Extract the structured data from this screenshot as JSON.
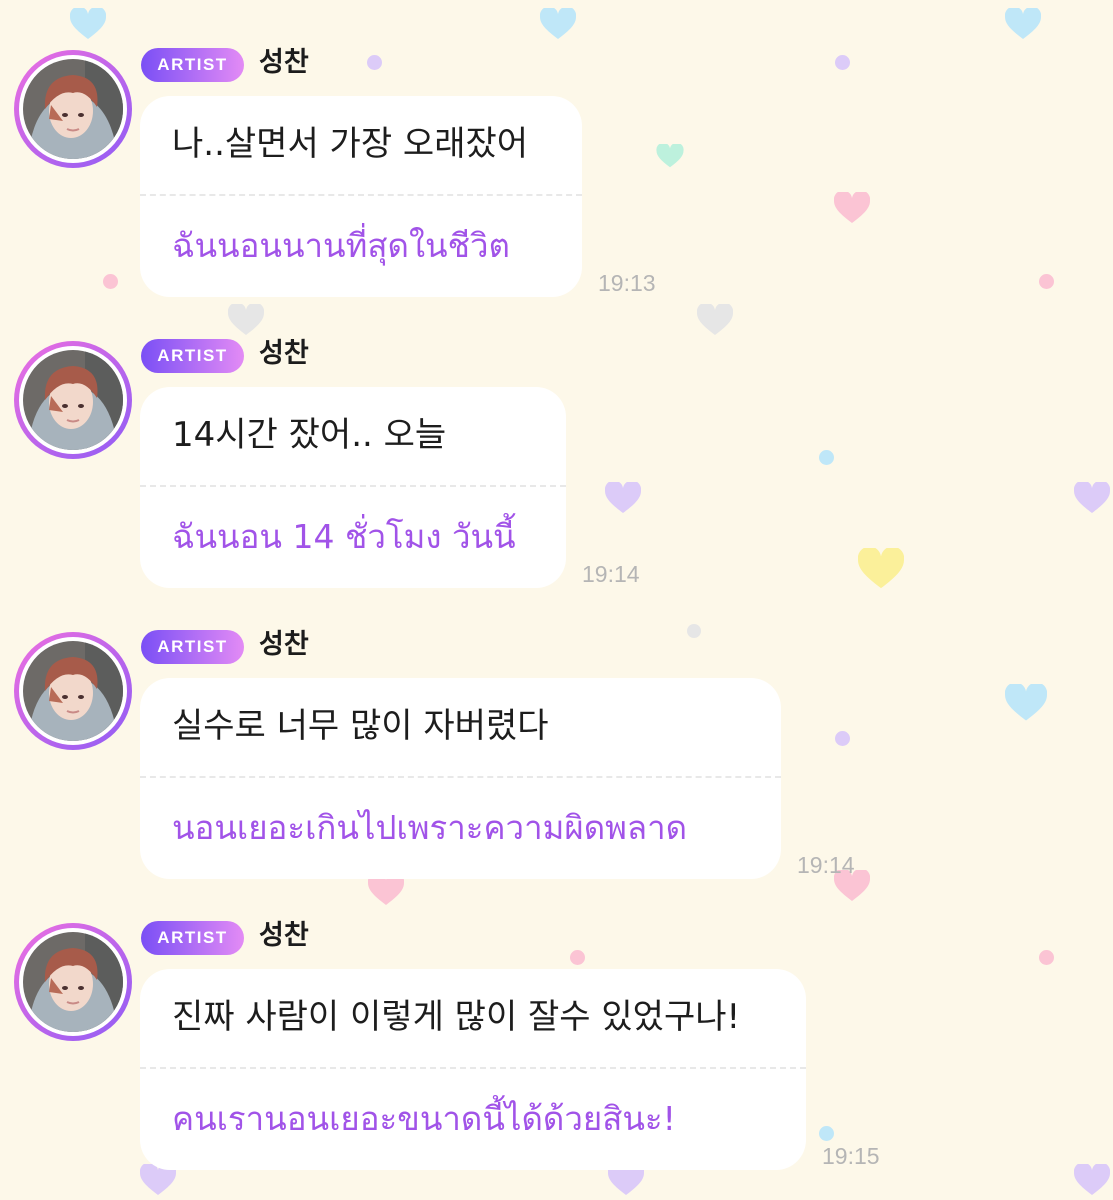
{
  "theme": {
    "background": "#fdf8e9",
    "badge_gradient": [
      "#7a4ff5",
      "#e38bf5"
    ],
    "translation_color": "#a153e8"
  },
  "messages": [
    {
      "badge": "ARTIST",
      "sender": "성찬",
      "text": "나..살면서 가장 오래잤어",
      "translation": "ฉันนอนนานที่สุดในชีวิต",
      "time": "19:13"
    },
    {
      "badge": "ARTIST",
      "sender": "성찬",
      "text": "14시간 잤어.. 오늘",
      "translation": "ฉันนอน 14 ชั่วโมง วันนี้",
      "time": "19:14"
    },
    {
      "badge": "ARTIST",
      "sender": "성찬",
      "text": "실수로 너무 많이 자버렸다",
      "translation": "นอนเยอะเกินไปเพราะความผิดพลาด",
      "time": "19:14"
    },
    {
      "badge": "ARTIST",
      "sender": "성찬",
      "text": "진짜 사람이 이렇게 많이 잘수 있었구나!",
      "translation": "คนเรานอนเยอะขนาดนี้ได้ด้วยสินะ!",
      "time": "19:15"
    }
  ]
}
